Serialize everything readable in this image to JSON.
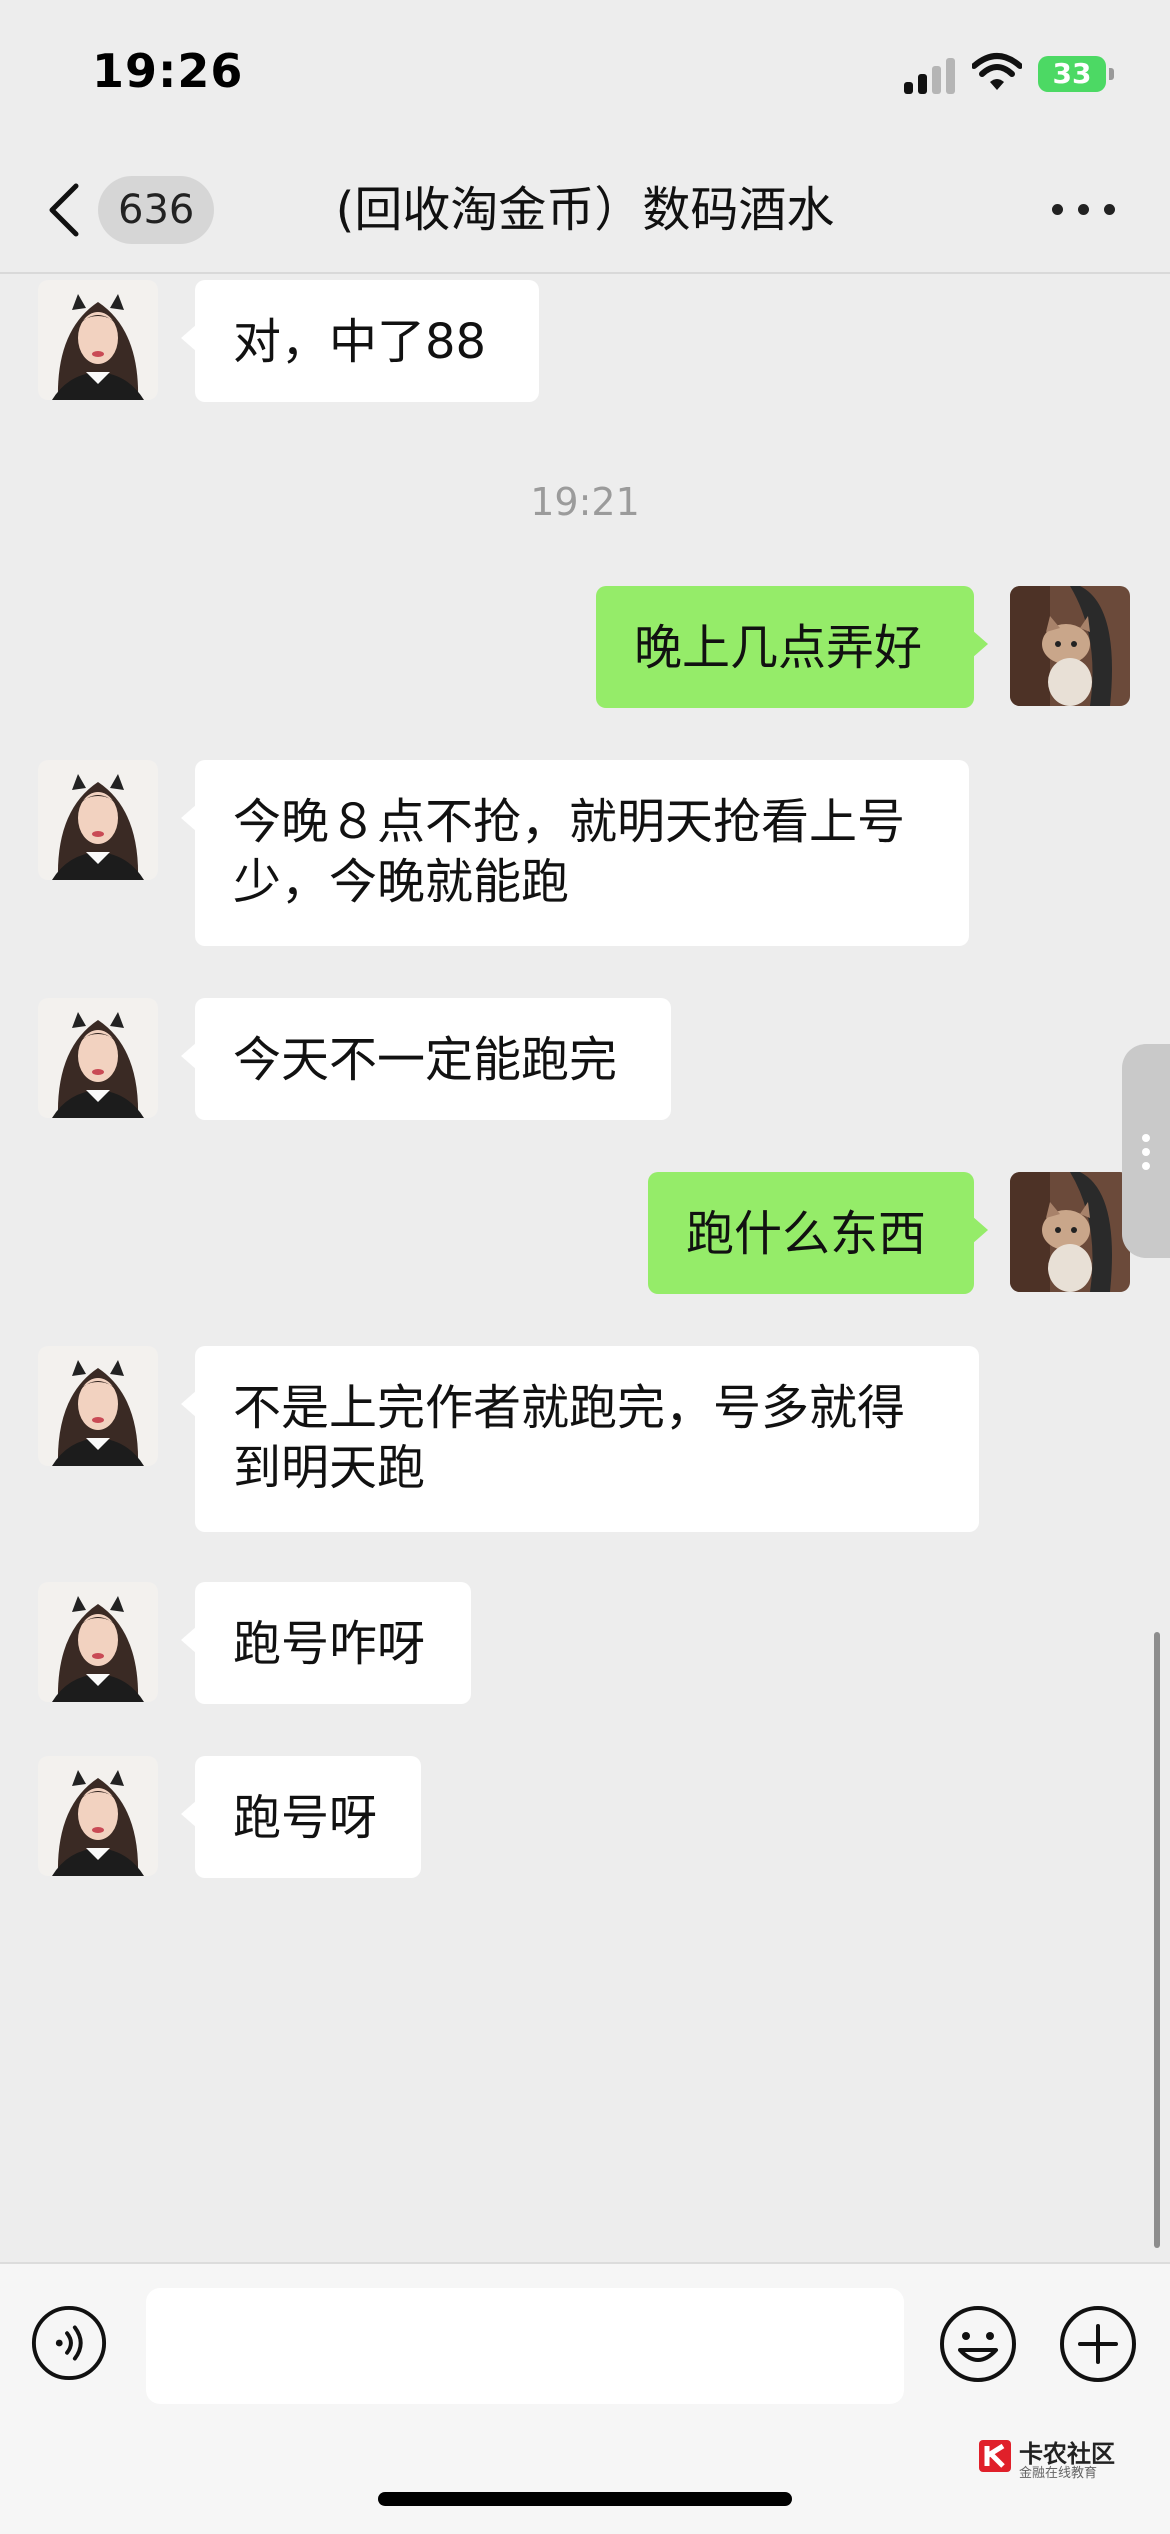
{
  "status_bar": {
    "time": "19:26",
    "battery": "33"
  },
  "nav": {
    "unread_count": "636",
    "title": "(回收淘金币）数码酒水"
  },
  "messages": [
    {
      "side": "in",
      "text": "对，中了88"
    },
    {
      "type": "time",
      "text": "19:21"
    },
    {
      "side": "out",
      "text": "晚上几点弄好"
    },
    {
      "side": "in",
      "text": "今晚８点不抢，就明天抢看上号少，今晚就能跑"
    },
    {
      "side": "in",
      "text": "今天不一定能跑完"
    },
    {
      "side": "out",
      "text": "跑什么东西"
    },
    {
      "side": "in",
      "text": "不是上完作者就跑完，号多就得到明天跑"
    },
    {
      "side": "in",
      "text": "跑号咋呀"
    },
    {
      "side": "in",
      "text": "跑号呀"
    }
  ],
  "watermark": {
    "name": "卡农社区",
    "sub": "金融在线教育"
  },
  "colors": {
    "outgoing_bubble": "#95ec69",
    "incoming_bubble": "#ffffff",
    "background": "#ededed"
  },
  "icons": {
    "back": "chevron-left-icon",
    "more": "more-dots-icon",
    "voice": "voice-icon",
    "emoji": "emoji-icon",
    "plus": "plus-icon"
  }
}
